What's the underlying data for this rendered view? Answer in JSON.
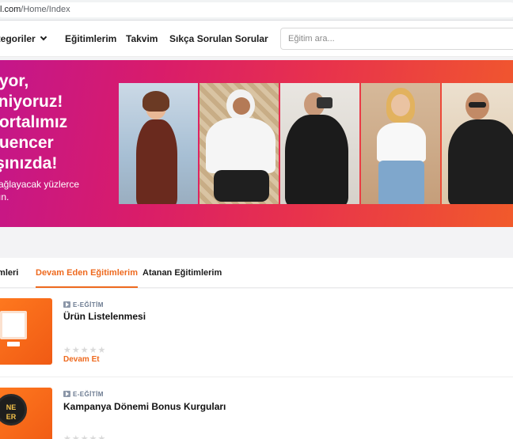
{
  "browser": {
    "url_host": "l.com",
    "url_path": "/Home/Index"
  },
  "header": {
    "nav": {
      "categories": "ategoriler",
      "trainings": "Eğitimlerim",
      "calendar": "Takvim",
      "faq": "Sıkça Sorulan Sorular"
    },
    "search_placeholder": "Eğitim ara..."
  },
  "banner": {
    "headline_lines": [
      "üyor,",
      "eniyoruz!",
      " portalımız",
      "fluencer",
      "rşınızda!"
    ],
    "sub_lines": [
      " sağlayacak yüzlerce",
      "şın."
    ]
  },
  "tabs": {
    "all": "imleri",
    "ongoing": "Devam Eden Eğitimlerim",
    "assigned": "Atanan Eğitimlerim"
  },
  "courses": [
    {
      "type": "E-EĞİTİM",
      "title": "Ürün Listelenmesi",
      "rating_stars": "★★★★★",
      "rating": 0,
      "action": "Devam Et"
    },
    {
      "type": "E-EĞİTİM",
      "title": "Kampanya Dönemi Bonus Kurguları",
      "rating_stars": "★★★★★",
      "rating": 0,
      "thumb_text": "NE\nER"
    }
  ],
  "colors": {
    "accent": "#ee6a1f",
    "banner_start": "#c4168a",
    "banner_end": "#f15a2b"
  }
}
